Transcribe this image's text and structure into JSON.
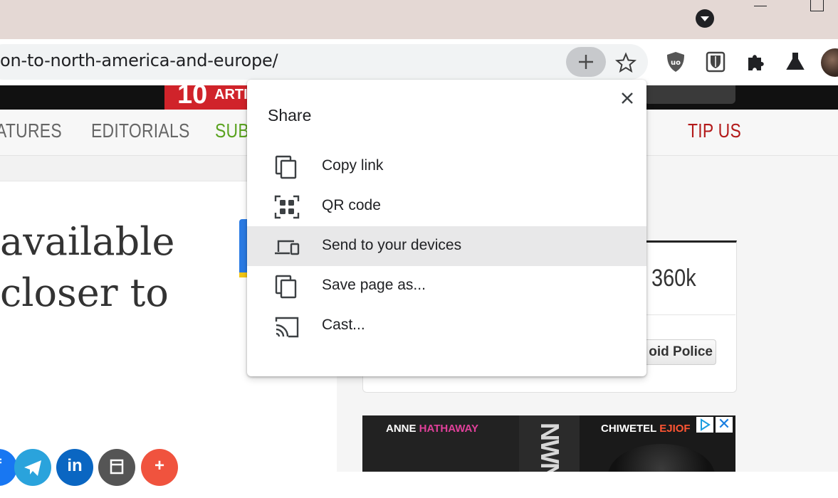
{
  "browser": {
    "url": "on-to-north-america-and-europe/"
  },
  "site": {
    "logo_num": "10",
    "logo_word": "ARTIC",
    "nav": {
      "features": "ATURES",
      "editorials": "EDITORIALS",
      "subscribe": "SUBS",
      "tip_us": "TIP US"
    },
    "headline_lines": [
      "available",
      "closer to"
    ],
    "widget": {
      "count": "360k",
      "follow_label": "oid Police"
    },
    "ad": {
      "name_left_1": "ANNE ",
      "name_left_2": "HATHAWAY",
      "name_right_1": "CHIWETEL ",
      "name_right_2": "EJIOF",
      "vertical": "NWN",
      "close": "✕"
    },
    "social_glyphs": [
      "f",
      "",
      "in",
      "",
      "+"
    ]
  },
  "share_menu": {
    "title": "Share",
    "items": [
      {
        "label": "Copy link",
        "icon": "copy-icon",
        "highlighted": false
      },
      {
        "label": "QR code",
        "icon": "qr-code-icon",
        "highlighted": false
      },
      {
        "label": "Send to your devices",
        "icon": "devices-icon",
        "highlighted": true
      },
      {
        "label": "Save page as...",
        "icon": "save-page-icon",
        "highlighted": false
      },
      {
        "label": "Cast...",
        "icon": "cast-icon",
        "highlighted": false
      }
    ]
  }
}
